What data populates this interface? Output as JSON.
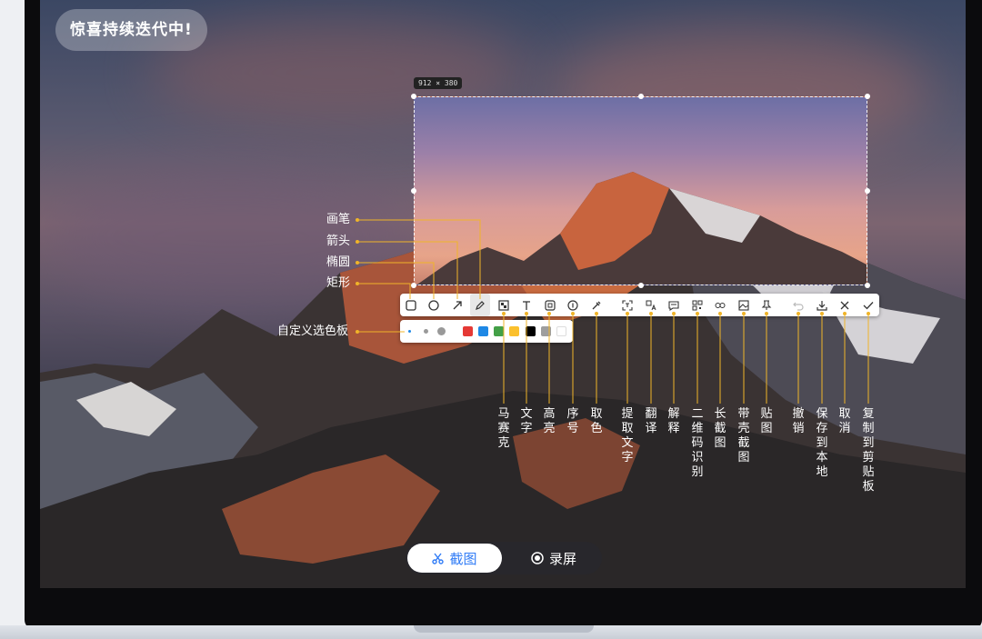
{
  "badge": "惊喜持续迭代中!",
  "selection_size": "912 × 380",
  "toolbar_icons": [
    "rect-icon",
    "ellipse-icon",
    "arrow-icon",
    "pen-icon",
    "mosaic-icon",
    "text-icon",
    "highlight-icon",
    "number-icon",
    "color-picker-icon",
    "ocr-icon",
    "translate-icon",
    "explain-icon",
    "qrcode-icon",
    "long-screenshot-icon",
    "device-frame-icon",
    "pin-icon",
    "undo-icon",
    "save-icon",
    "close-icon",
    "check-icon"
  ],
  "left_labels": {
    "pen": "画笔",
    "arrow": "箭头",
    "ellipse": "椭圆",
    "rect": "矩形",
    "palette": "自定义选色板"
  },
  "bottom_labels": {
    "mosaic": "马赛克",
    "text": "文字",
    "highlight": "高亮",
    "number": "序号",
    "picker": "取色",
    "ocr": "提取文字",
    "translate": "翻译",
    "explain": "解释",
    "qrcode": "二维码识别",
    "long": "长截图",
    "frame": "带壳截图",
    "pin": "贴图",
    "undo": "撤销",
    "save": "保存到本地",
    "cancel": "取消",
    "copy": "复制到剪贴板"
  },
  "palette_colors": [
    "#e53935",
    "#1e88e5",
    "#43a047",
    "#fbc02d",
    "#000000",
    "#9e9e9e",
    "#ffffff"
  ],
  "modes": {
    "screenshot": "截图",
    "record": "录屏"
  },
  "accent_color": "#2f7bf6",
  "callout_color": "#f0b429"
}
